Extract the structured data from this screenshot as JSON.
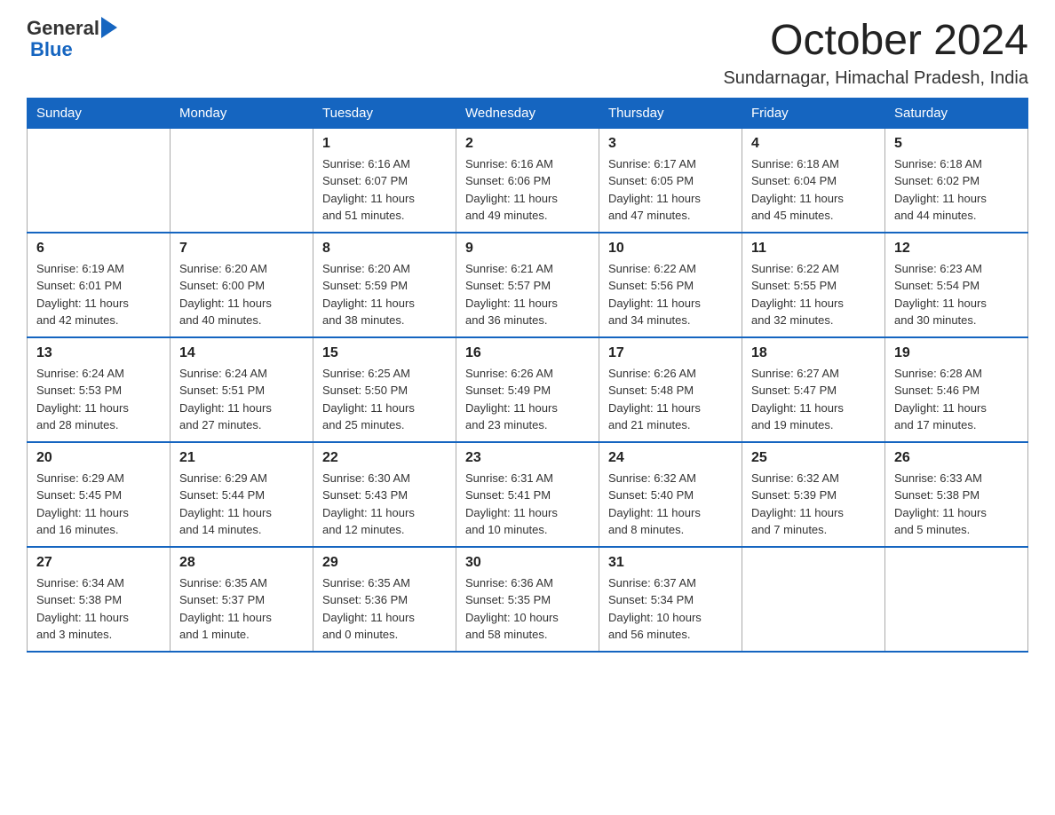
{
  "header": {
    "logo_general": "General",
    "logo_blue": "Blue",
    "month_title": "October 2024",
    "subtitle": "Sundarnagar, Himachal Pradesh, India"
  },
  "days_of_week": [
    "Sunday",
    "Monday",
    "Tuesday",
    "Wednesday",
    "Thursday",
    "Friday",
    "Saturday"
  ],
  "weeks": [
    [
      {
        "day": "",
        "info": ""
      },
      {
        "day": "",
        "info": ""
      },
      {
        "day": "1",
        "info": "Sunrise: 6:16 AM\nSunset: 6:07 PM\nDaylight: 11 hours\nand 51 minutes."
      },
      {
        "day": "2",
        "info": "Sunrise: 6:16 AM\nSunset: 6:06 PM\nDaylight: 11 hours\nand 49 minutes."
      },
      {
        "day": "3",
        "info": "Sunrise: 6:17 AM\nSunset: 6:05 PM\nDaylight: 11 hours\nand 47 minutes."
      },
      {
        "day": "4",
        "info": "Sunrise: 6:18 AM\nSunset: 6:04 PM\nDaylight: 11 hours\nand 45 minutes."
      },
      {
        "day": "5",
        "info": "Sunrise: 6:18 AM\nSunset: 6:02 PM\nDaylight: 11 hours\nand 44 minutes."
      }
    ],
    [
      {
        "day": "6",
        "info": "Sunrise: 6:19 AM\nSunset: 6:01 PM\nDaylight: 11 hours\nand 42 minutes."
      },
      {
        "day": "7",
        "info": "Sunrise: 6:20 AM\nSunset: 6:00 PM\nDaylight: 11 hours\nand 40 minutes."
      },
      {
        "day": "8",
        "info": "Sunrise: 6:20 AM\nSunset: 5:59 PM\nDaylight: 11 hours\nand 38 minutes."
      },
      {
        "day": "9",
        "info": "Sunrise: 6:21 AM\nSunset: 5:57 PM\nDaylight: 11 hours\nand 36 minutes."
      },
      {
        "day": "10",
        "info": "Sunrise: 6:22 AM\nSunset: 5:56 PM\nDaylight: 11 hours\nand 34 minutes."
      },
      {
        "day": "11",
        "info": "Sunrise: 6:22 AM\nSunset: 5:55 PM\nDaylight: 11 hours\nand 32 minutes."
      },
      {
        "day": "12",
        "info": "Sunrise: 6:23 AM\nSunset: 5:54 PM\nDaylight: 11 hours\nand 30 minutes."
      }
    ],
    [
      {
        "day": "13",
        "info": "Sunrise: 6:24 AM\nSunset: 5:53 PM\nDaylight: 11 hours\nand 28 minutes."
      },
      {
        "day": "14",
        "info": "Sunrise: 6:24 AM\nSunset: 5:51 PM\nDaylight: 11 hours\nand 27 minutes."
      },
      {
        "day": "15",
        "info": "Sunrise: 6:25 AM\nSunset: 5:50 PM\nDaylight: 11 hours\nand 25 minutes."
      },
      {
        "day": "16",
        "info": "Sunrise: 6:26 AM\nSunset: 5:49 PM\nDaylight: 11 hours\nand 23 minutes."
      },
      {
        "day": "17",
        "info": "Sunrise: 6:26 AM\nSunset: 5:48 PM\nDaylight: 11 hours\nand 21 minutes."
      },
      {
        "day": "18",
        "info": "Sunrise: 6:27 AM\nSunset: 5:47 PM\nDaylight: 11 hours\nand 19 minutes."
      },
      {
        "day": "19",
        "info": "Sunrise: 6:28 AM\nSunset: 5:46 PM\nDaylight: 11 hours\nand 17 minutes."
      }
    ],
    [
      {
        "day": "20",
        "info": "Sunrise: 6:29 AM\nSunset: 5:45 PM\nDaylight: 11 hours\nand 16 minutes."
      },
      {
        "day": "21",
        "info": "Sunrise: 6:29 AM\nSunset: 5:44 PM\nDaylight: 11 hours\nand 14 minutes."
      },
      {
        "day": "22",
        "info": "Sunrise: 6:30 AM\nSunset: 5:43 PM\nDaylight: 11 hours\nand 12 minutes."
      },
      {
        "day": "23",
        "info": "Sunrise: 6:31 AM\nSunset: 5:41 PM\nDaylight: 11 hours\nand 10 minutes."
      },
      {
        "day": "24",
        "info": "Sunrise: 6:32 AM\nSunset: 5:40 PM\nDaylight: 11 hours\nand 8 minutes."
      },
      {
        "day": "25",
        "info": "Sunrise: 6:32 AM\nSunset: 5:39 PM\nDaylight: 11 hours\nand 7 minutes."
      },
      {
        "day": "26",
        "info": "Sunrise: 6:33 AM\nSunset: 5:38 PM\nDaylight: 11 hours\nand 5 minutes."
      }
    ],
    [
      {
        "day": "27",
        "info": "Sunrise: 6:34 AM\nSunset: 5:38 PM\nDaylight: 11 hours\nand 3 minutes."
      },
      {
        "day": "28",
        "info": "Sunrise: 6:35 AM\nSunset: 5:37 PM\nDaylight: 11 hours\nand 1 minute."
      },
      {
        "day": "29",
        "info": "Sunrise: 6:35 AM\nSunset: 5:36 PM\nDaylight: 11 hours\nand 0 minutes."
      },
      {
        "day": "30",
        "info": "Sunrise: 6:36 AM\nSunset: 5:35 PM\nDaylight: 10 hours\nand 58 minutes."
      },
      {
        "day": "31",
        "info": "Sunrise: 6:37 AM\nSunset: 5:34 PM\nDaylight: 10 hours\nand 56 minutes."
      },
      {
        "day": "",
        "info": ""
      },
      {
        "day": "",
        "info": ""
      }
    ]
  ]
}
